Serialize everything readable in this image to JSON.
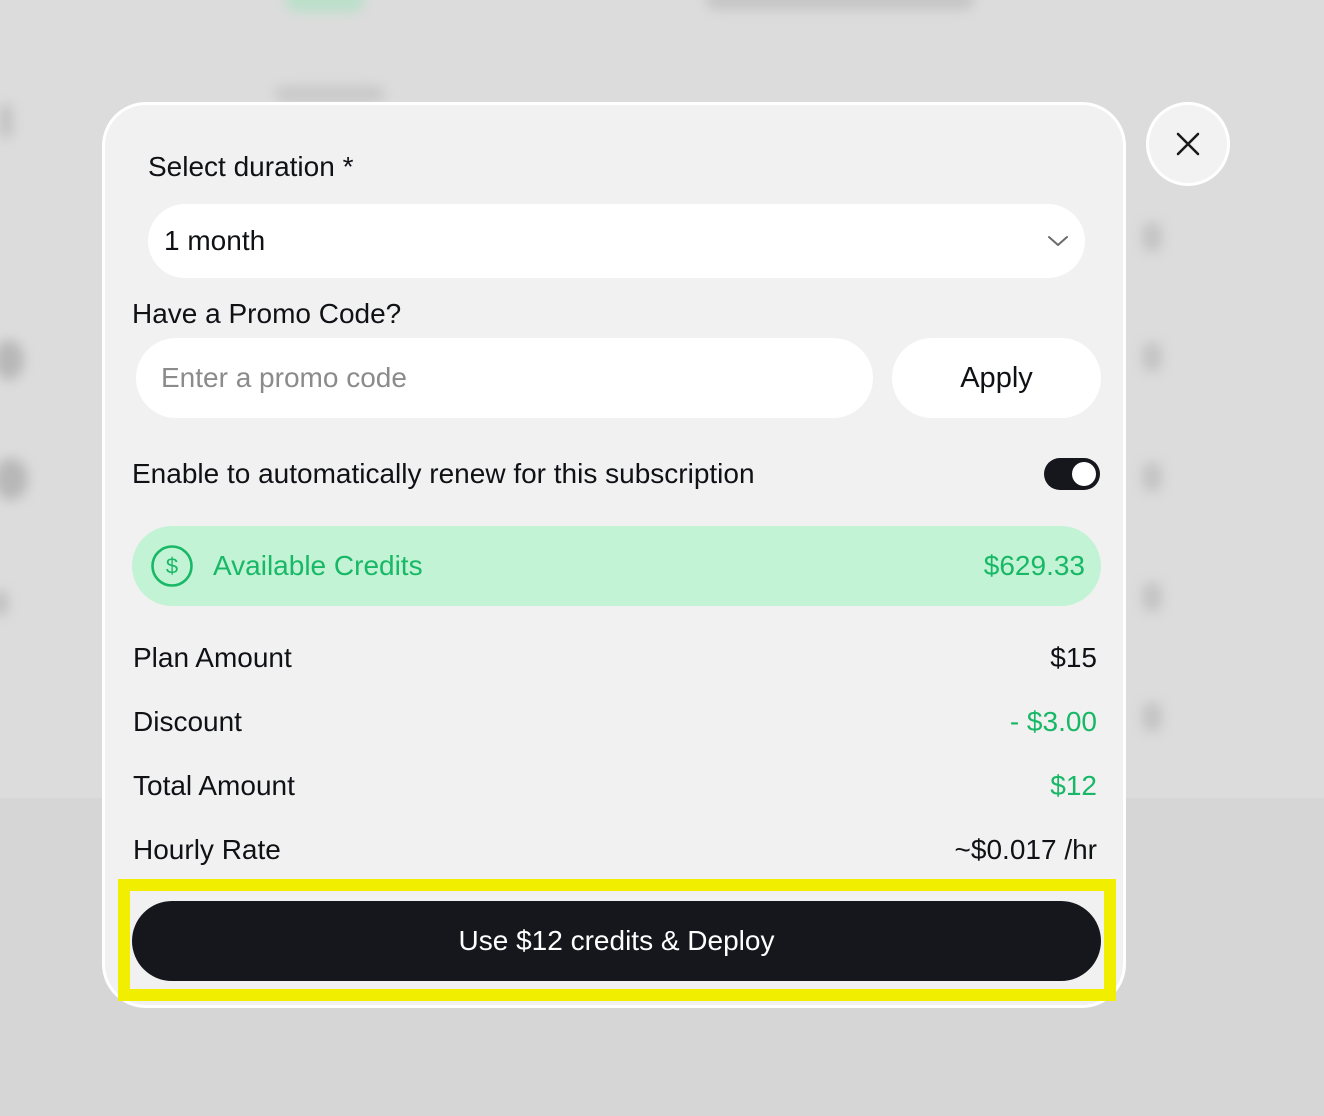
{
  "modal": {
    "duration_label": "Select duration *",
    "duration_value": "1 month",
    "promo_label": "Have a Promo Code?",
    "promo_placeholder": "Enter a promo code",
    "promo_value": "",
    "apply_label": "Apply",
    "auto_renew_label": "Enable to automatically renew for this subscription",
    "auto_renew_enabled": true,
    "credits": {
      "icon": "dollar-circle-icon",
      "label": "Available Credits",
      "value": "$629.33"
    },
    "summary": {
      "plan_amount_label": "Plan Amount",
      "plan_amount_value": "$15",
      "discount_label": "Discount",
      "discount_value": "- $3.00",
      "total_label": "Total Amount",
      "total_value": "$12",
      "hourly_label": "Hourly Rate",
      "hourly_value": "~$0.017 /hr"
    },
    "deploy_label": "Use $12 credits & Deploy"
  },
  "icons": {
    "close": "close-icon",
    "dropdown": "chevron-down-icon"
  },
  "colors": {
    "accent_green": "#18b866",
    "credits_bg": "#c3f3d5",
    "primary_button": "#15171c",
    "highlight": "#f2ee00"
  }
}
